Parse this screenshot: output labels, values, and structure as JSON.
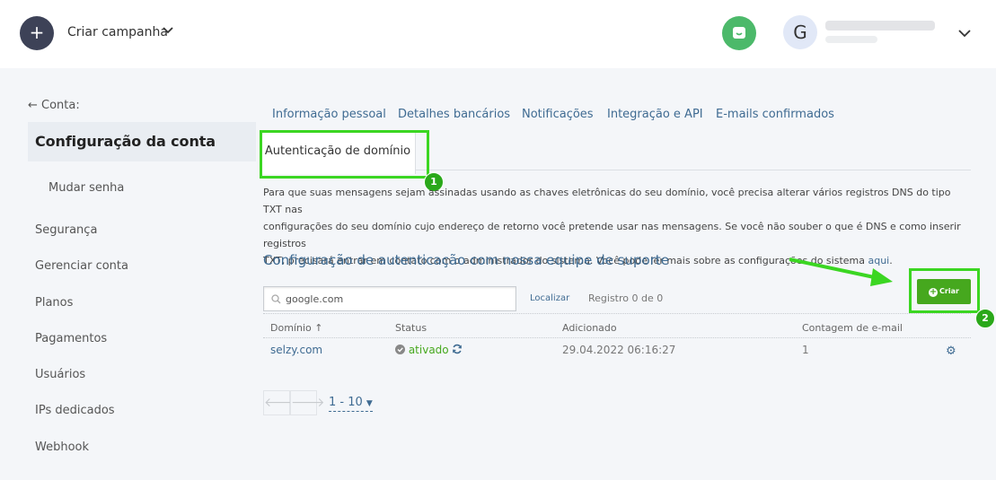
{
  "header": {
    "plus": "+",
    "create_campaign": "Criar campanha",
    "avatar_initial": "G"
  },
  "sidebar": {
    "back": "← Conta:",
    "title": "Configuração da conta",
    "items": [
      "Mudar senha",
      "Segurança",
      "Gerenciar conta",
      "Planos",
      "Pagamentos",
      "Usuários",
      "IPs dedicados",
      "Webhook"
    ]
  },
  "tabs": {
    "items": [
      "Informação pessoal",
      "Detalhes bancários",
      "Notificações",
      "Integração e API",
      "E-mails confirmados"
    ],
    "active": "Autenticação de domínio"
  },
  "description": {
    "line1": "Para que suas mensagens sejam assinadas usando as chaves eletrônicas do seu domínio, você precisa alterar vários registros DNS do tipo TXT nas",
    "line2": "configurações do seu domínio cujo endereço de retorno você pretende usar nas mensagens. Se você não souber o que é DNS e como inserir registros",
    "line3": "TXT, precisará entrar em contato com o administrador do sistema. Você pode ler mais sobre as configurações do sistema",
    "link": "aqui",
    "end": "."
  },
  "section_title": "Configuração de autenticação com nossa equipe de suporte",
  "search": {
    "value": "google.com",
    "button": "Localizar",
    "records": "Registro 0 de 0"
  },
  "create_button": "Criar",
  "table": {
    "headers": [
      "Domínio ↑",
      "Status",
      "Adicionado",
      "Contagem de e-mail"
    ],
    "rows": [
      {
        "domain": "selzy.com",
        "status": "ativado",
        "added": "29.04.2022 06:16:27",
        "count": "1"
      }
    ]
  },
  "pagination": {
    "prev": "🡐",
    "next": "🡒",
    "range": "1 - 10"
  },
  "annotations": {
    "badge1": "1",
    "badge2": "2"
  },
  "colors": {
    "accent": "#3f6b92",
    "highlight": "#3bd622",
    "success": "#46a81e"
  }
}
